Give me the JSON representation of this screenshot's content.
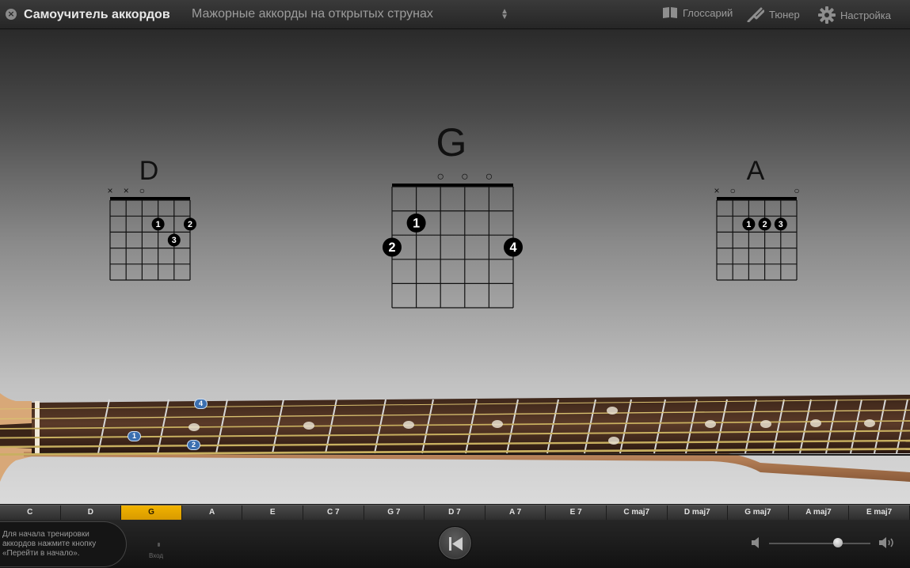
{
  "app": {
    "title": "Самоучитель аккордов",
    "close_icon": "close-circle-icon"
  },
  "lesson": {
    "selected": "Мажорные аккорды на открытых струнах"
  },
  "toolbar": {
    "glossary_label": "Глоссарий",
    "glossary_icon": "book-icon",
    "tuner_label": "Тюнер",
    "tuner_icon": "tuning-fork-icon",
    "settings_label": "Настройка",
    "settings_icon": "gear-icon"
  },
  "chords": {
    "left": {
      "name": "D",
      "markers": [
        "×",
        "×",
        "○",
        "",
        "",
        ""
      ],
      "dots": [
        {
          "string": 4,
          "fret": 2,
          "finger": "1"
        },
        {
          "string": 6,
          "fret": 2,
          "finger": "2"
        },
        {
          "string": 5,
          "fret": 3,
          "finger": "3"
        }
      ]
    },
    "center": {
      "name": "G",
      "markers": [
        "",
        "",
        "○",
        "○",
        "○",
        ""
      ],
      "dots": [
        {
          "string": 2,
          "fret": 2,
          "finger": "1"
        },
        {
          "string": 1,
          "fret": 3,
          "finger": "2"
        },
        {
          "string": 6,
          "fret": 3,
          "finger": "4"
        }
      ]
    },
    "right": {
      "name": "A",
      "markers": [
        "×",
        "○",
        "",
        "",
        "",
        "○"
      ],
      "dots": [
        {
          "string": 3,
          "fret": 2,
          "finger": "1"
        },
        {
          "string": 4,
          "fret": 2,
          "finger": "2"
        },
        {
          "string": 5,
          "fret": 2,
          "finger": "3"
        }
      ]
    }
  },
  "fretboard": {
    "finger_markers": [
      "4",
      "1",
      "2"
    ]
  },
  "chord_strip": {
    "items": [
      "C",
      "D",
      "G",
      "A",
      "E",
      "C 7",
      "G 7",
      "D 7",
      "A 7",
      "E 7",
      "C maj7",
      "D maj7",
      "G maj7",
      "A maj7",
      "E maj7"
    ],
    "active_index": 2,
    "active_color": "#f0b000"
  },
  "bottom": {
    "hint_text": "Для начала тренировки аккордов нажмите кнопку «Перейти в начало».",
    "input_label": "Вход",
    "rewind_icon": "skip-to-start-icon",
    "volume_low_icon": "speaker-low-icon",
    "volume_high_icon": "speaker-high-icon",
    "volume_level": 0.68
  }
}
